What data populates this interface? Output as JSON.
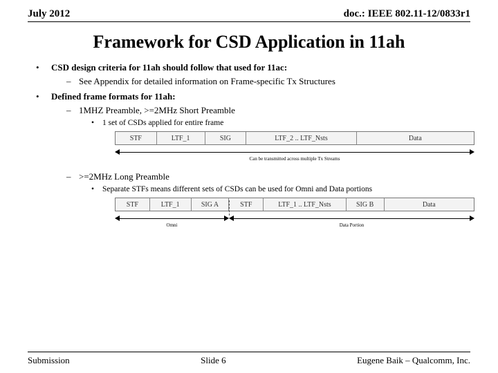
{
  "header": {
    "left": "July 2012",
    "right": "doc.: IEEE 802.11-12/0833r1"
  },
  "title": "Framework for CSD Application in 11ah",
  "bullets": {
    "b1": "CSD design criteria for 11ah should follow that used for 11ac:",
    "b1a": "See Appendix for detailed information on Frame-specific Tx Structures",
    "b2": "Defined frame formats for 11ah:",
    "b2a": "1MHZ Preamble, >=2MHz Short Preamble",
    "b2a1": "1 set of CSDs applied for entire frame",
    "b2b": ">=2MHz Long Preamble",
    "b2b1": "Separate STFs means different sets of CSDs can be used for Omni and Data portions"
  },
  "fig1": {
    "segs": [
      "STF",
      "LTF_1",
      "SIG",
      "LTF_2 .. LTF_Nsts",
      "Data"
    ],
    "widths": [
      60,
      70,
      60,
      160,
      170
    ],
    "arrow_label": "Can be transmitted across multiple Tx Streams"
  },
  "fig2": {
    "segs": [
      "STF",
      "LTF_1",
      "SIG A",
      "STF",
      "LTF_1 .. LTF_Nsts",
      "SIG B",
      "Data"
    ],
    "widths": [
      50,
      60,
      55,
      50,
      120,
      55,
      130
    ],
    "arrow1_label": "Omni",
    "arrow2_label": "Data Portion"
  },
  "footer": {
    "left": "Submission",
    "center": "Slide 6",
    "right": "Eugene Baik – Qualcomm, Inc."
  }
}
